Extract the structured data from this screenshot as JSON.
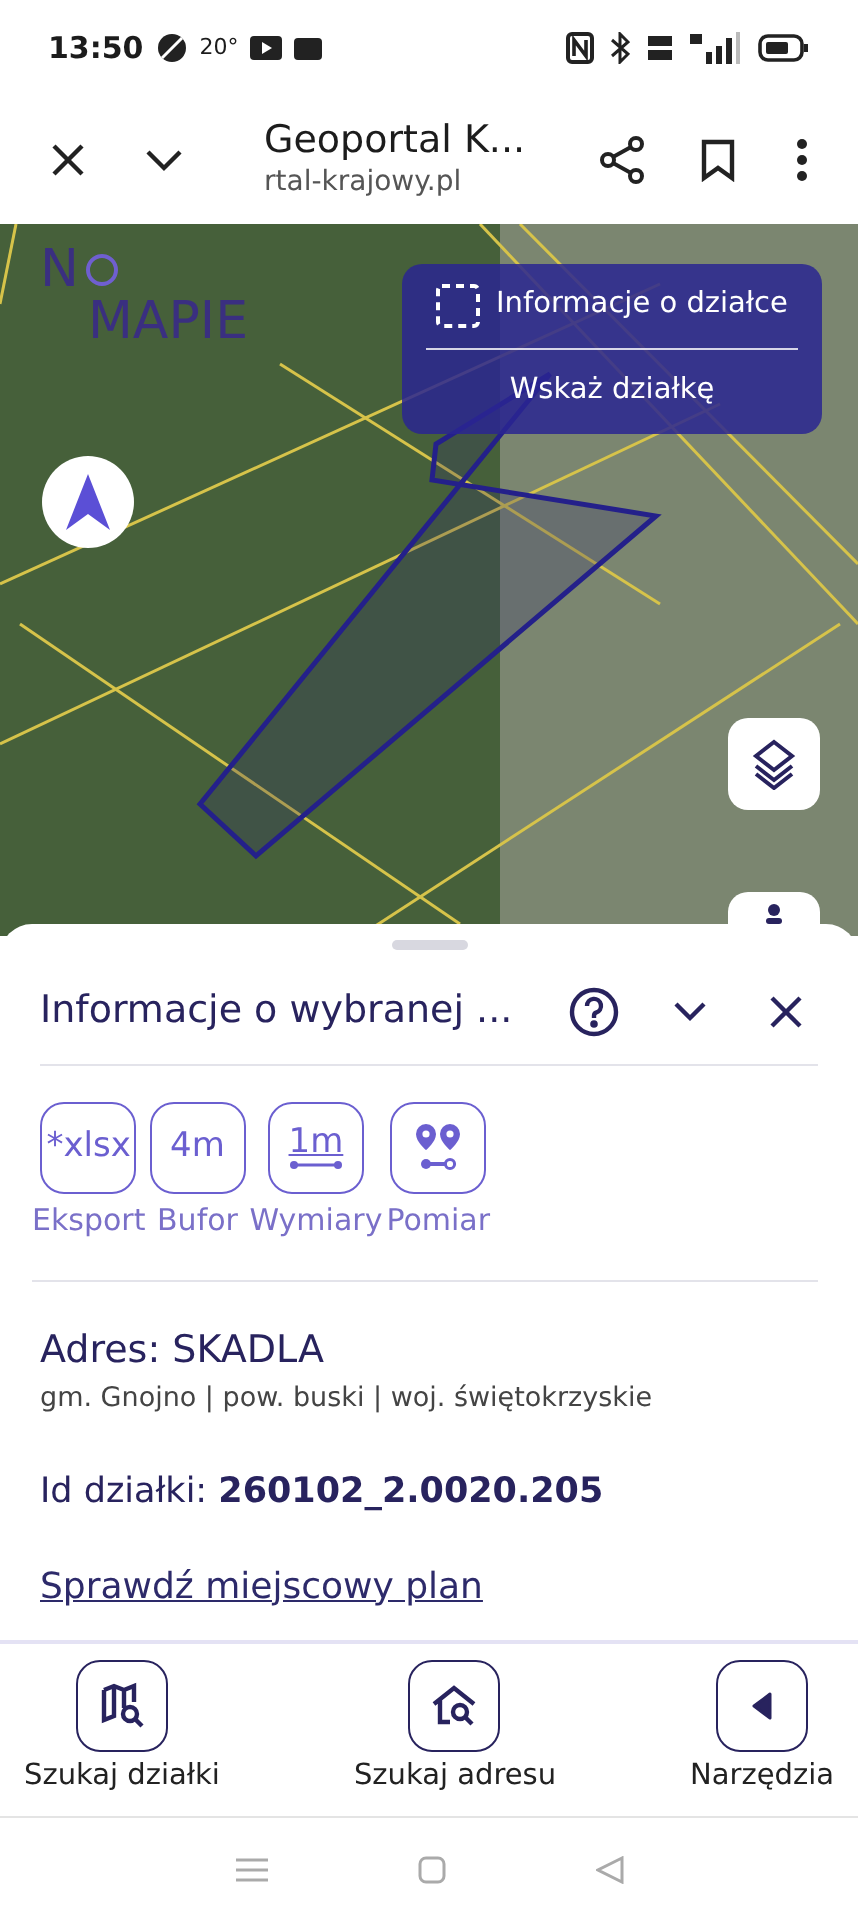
{
  "status_bar": {
    "time": "13:50",
    "temperature": "20°"
  },
  "browser": {
    "title": "Geoportal K...",
    "url": "rtal-krajowy.pl"
  },
  "map": {
    "logo": [
      "N",
      "MAPIE"
    ],
    "menu": [
      {
        "label": "Informacje o działce",
        "kind": "icon"
      },
      {
        "label": "Wskaż działkę",
        "kind": "plain"
      }
    ]
  },
  "sheet": {
    "title": "Informacje o wybranej ...",
    "tools": [
      {
        "badge": "*xlsx",
        "label": "Eksport",
        "kind": "text"
      },
      {
        "badge": "4m",
        "label": "Bufor",
        "kind": "text"
      },
      {
        "badge": "1m",
        "label": "Wymiary",
        "kind": "ruler"
      },
      {
        "label": "Pomiar",
        "kind": "pins"
      }
    ],
    "address": "Adres: SKADLA",
    "region": "gm. Gnojno | pow. buski | woj. świętokrzyskie",
    "parcel_id": "Id działki: **260102_2.0020.205**",
    "plan_link": "Sprawdź miejscowy plan"
  },
  "bottom_nav": [
    {
      "label": "Szukaj działki",
      "kind": "map"
    },
    {
      "label": "Szukaj adresu",
      "kind": "house"
    },
    {
      "label": "Narzędzia",
      "kind": "back"
    }
  ]
}
